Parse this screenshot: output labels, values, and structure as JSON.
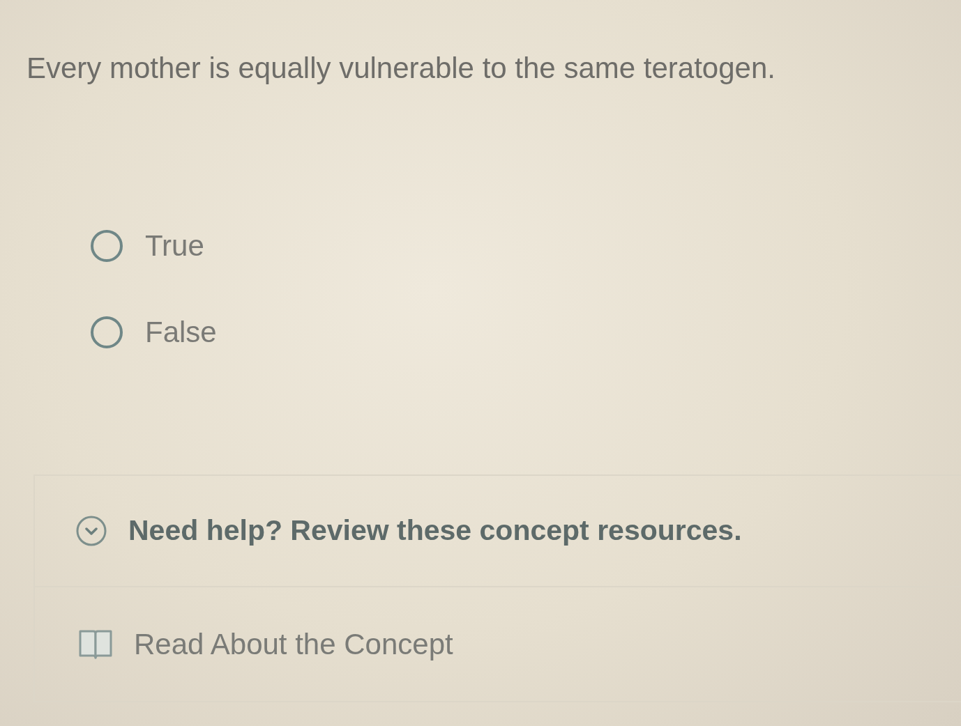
{
  "question": {
    "text": "Every mother is equally vulnerable to the same teratogen."
  },
  "options": [
    {
      "label": "True",
      "selected": false
    },
    {
      "label": "False",
      "selected": false
    }
  ],
  "help": {
    "title": "Need help? Review these concept resources.",
    "expanded": true,
    "resources": [
      {
        "label": "Read About the Concept"
      }
    ]
  }
}
